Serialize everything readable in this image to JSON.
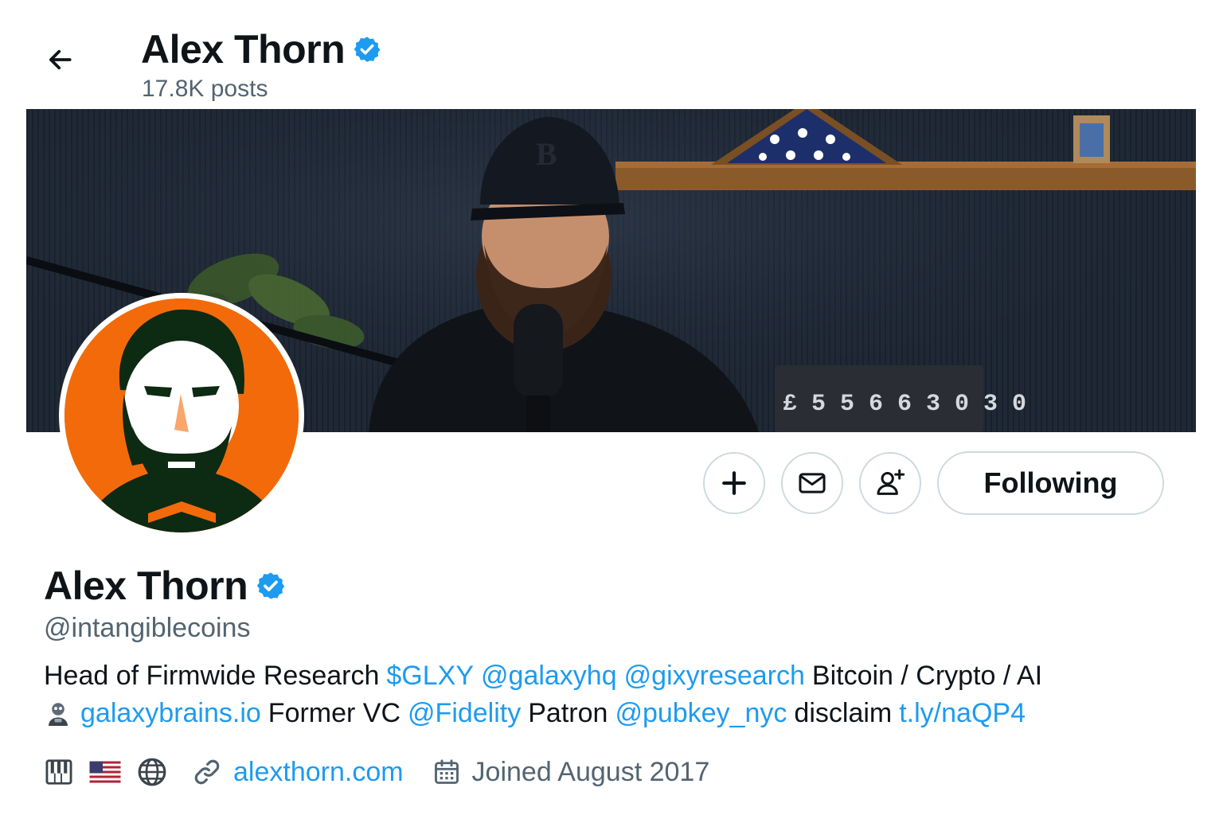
{
  "header": {
    "name": "Alex Thorn",
    "posts": "17.8K posts"
  },
  "banner": {
    "counter": "£ 5 5 6 6 3 0 3 0"
  },
  "actions": {
    "following_label": "Following"
  },
  "profile": {
    "name": "Alex Thorn",
    "handle": "@intangiblecoins",
    "bio": {
      "line1": {
        "t1": "Head of Firmwide Research",
        "l1": "$GLXY",
        "l2": "@galaxyhq",
        "l3": "@gixyresearch",
        "t2": "Bitcoin / Crypto / AI"
      },
      "line2": {
        "l1": "galaxybrains.io",
        "t1": "Former VC",
        "l2": "@Fidelity",
        "t2": "Patron",
        "l3": "@pubkey_nyc",
        "t3": "disclaim",
        "l4": "t.ly/naQP4"
      }
    },
    "meta": {
      "website": "alexthorn.com",
      "joined": "Joined August 2017"
    }
  },
  "colors": {
    "accent": "#1d9bf0",
    "text": "#0f1419",
    "secondary": "#536471",
    "avatar_bg": "#f36a0a"
  },
  "icons": [
    "back-arrow-icon",
    "verified-badge-icon",
    "plus-icon",
    "mail-icon",
    "add-person-icon",
    "piano-keys-emoji-icon",
    "us-flag-emoji-icon",
    "globe-emoji-icon",
    "link-icon",
    "calendar-icon",
    "brain-hacker-emoji-icon"
  ]
}
